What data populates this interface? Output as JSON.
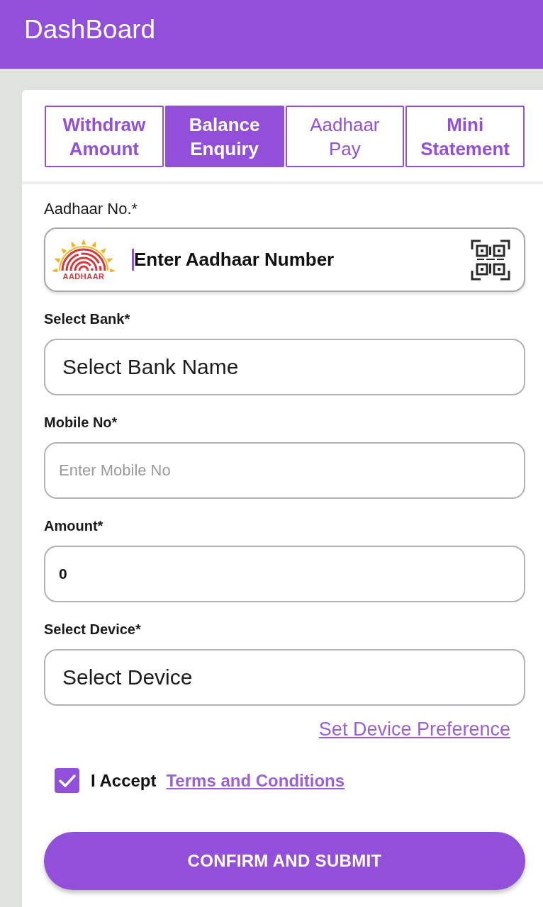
{
  "header": {
    "title": "DashBoard"
  },
  "tabs": [
    {
      "label": "Withdraw Amount",
      "selected": false,
      "bold": true
    },
    {
      "label": "Balance Enquiry",
      "selected": true,
      "bold": true
    },
    {
      "label": "Aadhaar Pay",
      "selected": false,
      "bold": false
    },
    {
      "label": "Mini Statement",
      "selected": false,
      "bold": true
    }
  ],
  "form": {
    "fields": [
      {
        "kind": "aadhaar",
        "label": "Aadhaar No.*",
        "placeholder": "Enter Aadhaar Number",
        "logo_text": "AADHAAR",
        "focused": true
      },
      {
        "kind": "select",
        "label": "Select Bank*",
        "placeholder": "Select Bank Name"
      },
      {
        "kind": "input",
        "label": "Mobile No*",
        "placeholder": "Enter Mobile No"
      },
      {
        "kind": "input",
        "label": "Amount*",
        "value": "0"
      },
      {
        "kind": "select",
        "label": "Select Device*",
        "placeholder": "Select Device"
      }
    ],
    "device_link": "Set Device Preference",
    "terms": {
      "checked": true,
      "label": "I Accept",
      "link": "Terms and Conditions"
    },
    "submit": "CONFIRM AND SUBMIT"
  }
}
